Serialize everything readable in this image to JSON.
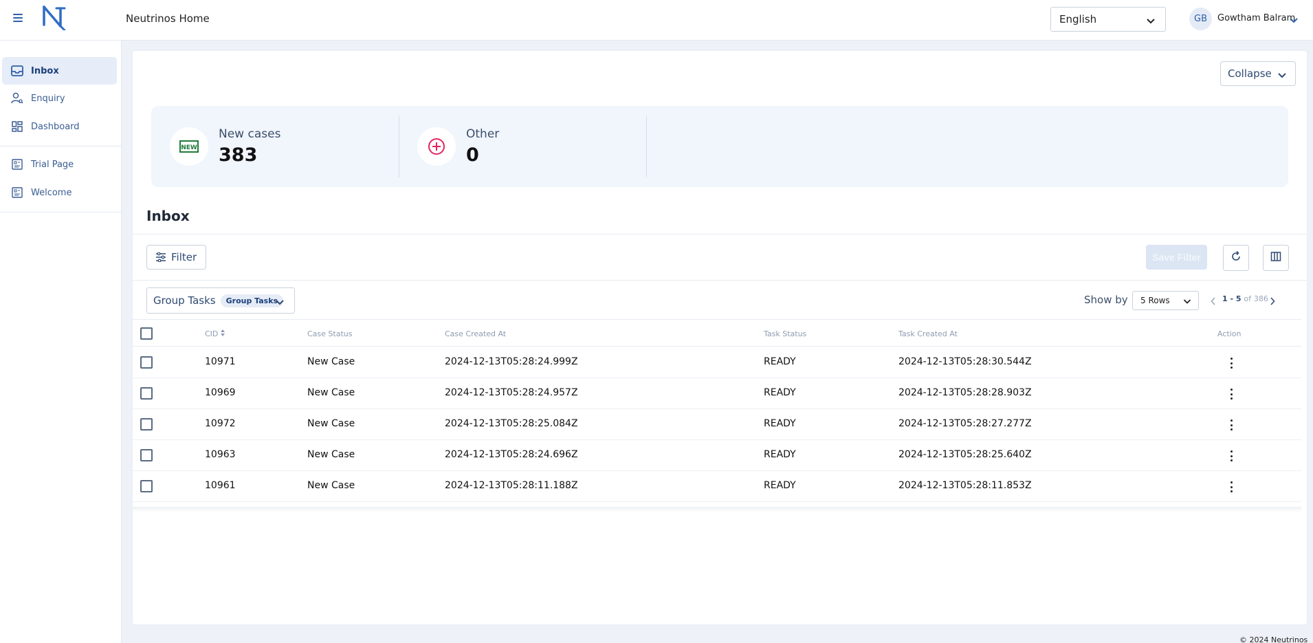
{
  "header": {
    "app_title": "Neutrinos Home",
    "language": "English",
    "user_initials": "GB",
    "user_name": "Gowtham Balram"
  },
  "sidebar": {
    "items": [
      {
        "label": "Inbox",
        "icon": "inbox-icon",
        "active": true
      },
      {
        "label": "Enquiry",
        "icon": "user-search-icon",
        "active": false
      },
      {
        "label": "Dashboard",
        "icon": "dashboard-icon",
        "active": false
      },
      {
        "label": "Trial Page",
        "icon": "page-icon",
        "active": false
      },
      {
        "label": "Welcome",
        "icon": "page-icon",
        "active": false
      }
    ]
  },
  "main": {
    "collapse_label": "Collapse",
    "stats": [
      {
        "label": "New cases",
        "value": "383",
        "icon": "new-badge-icon"
      },
      {
        "label": "Other",
        "value": "0",
        "icon": "plus-circle-icon"
      }
    ],
    "new_badge_text": "NEW",
    "section_title": "Inbox",
    "filter_label": "Filter",
    "save_filter_label": "Save Filter",
    "group_select_label": "Group Tasks",
    "group_chip": "Group Tasks",
    "show_by_label": "Show by",
    "rows_option": "5 Rows",
    "pager_range": "1 - 5",
    "pager_of": "of",
    "pager_total": "386"
  },
  "table": {
    "columns": [
      "CID",
      "Case Status",
      "Case Created At",
      "Task Status",
      "Task Created At",
      "Action"
    ],
    "rows": [
      {
        "cid": "10971",
        "case_status": "New Case",
        "case_created": "2024-12-13T05:28:24.999Z",
        "task_status": "READY",
        "task_created": "2024-12-13T05:28:30.544Z"
      },
      {
        "cid": "10969",
        "case_status": "New Case",
        "case_created": "2024-12-13T05:28:24.957Z",
        "task_status": "READY",
        "task_created": "2024-12-13T05:28:28.903Z"
      },
      {
        "cid": "10972",
        "case_status": "New Case",
        "case_created": "2024-12-13T05:28:25.084Z",
        "task_status": "READY",
        "task_created": "2024-12-13T05:28:27.277Z"
      },
      {
        "cid": "10963",
        "case_status": "New Case",
        "case_created": "2024-12-13T05:28:24.696Z",
        "task_status": "READY",
        "task_created": "2024-12-13T05:28:25.640Z"
      },
      {
        "cid": "10961",
        "case_status": "New Case",
        "case_created": "2024-12-13T05:28:11.188Z",
        "task_status": "READY",
        "task_created": "2024-12-13T05:28:11.853Z"
      }
    ]
  },
  "footer": {
    "copyright": "© 2024 Neutrinos"
  },
  "colors": {
    "brand": "#2f5fa8",
    "accent_pink": "#e0245e",
    "badge_green": "#1f7a3a"
  }
}
